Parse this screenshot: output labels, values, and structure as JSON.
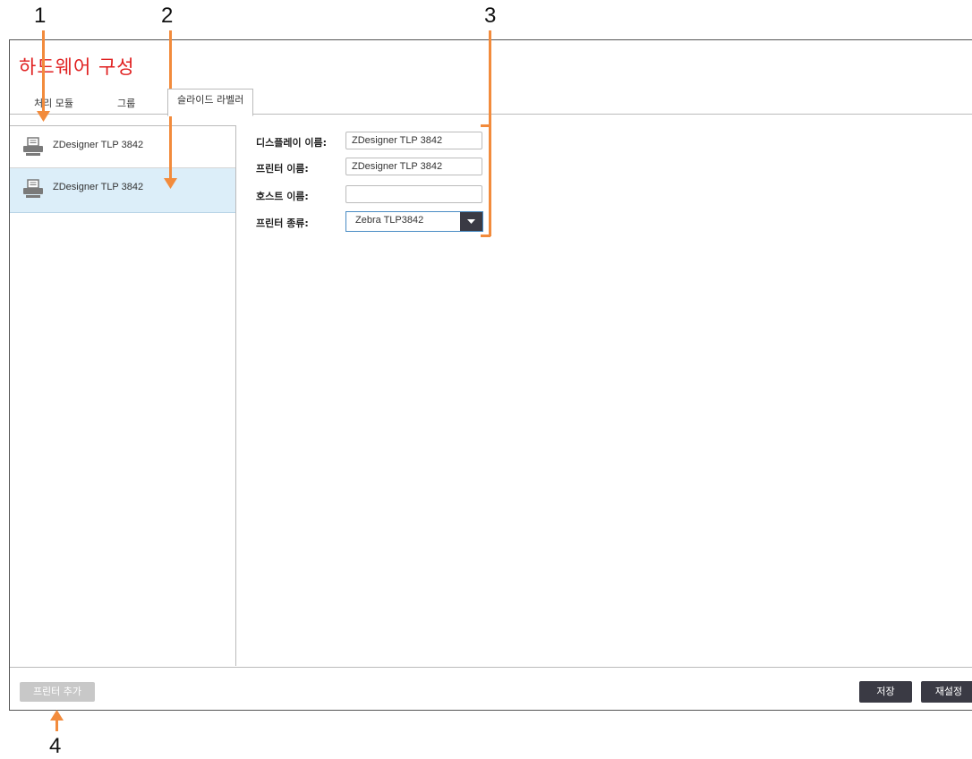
{
  "callouts": [
    "1",
    "2",
    "3",
    "4"
  ],
  "window": {
    "title": "하드웨어 구성"
  },
  "tabs": [
    {
      "label": "처리 모듈",
      "active": false
    },
    {
      "label": "그룹",
      "active": false
    },
    {
      "label": "슬라이드 라벨러",
      "active": true
    }
  ],
  "printers": [
    {
      "name": "ZDesigner TLP 3842",
      "selected": false,
      "icon": "printer-icon"
    },
    {
      "name": "ZDesigner TLP 3842",
      "selected": true,
      "icon": "printer-icon"
    }
  ],
  "form": {
    "display_name_label": "디스플레이 이름:",
    "display_name_value": "ZDesigner TLP 3842",
    "printer_name_label": "프린터 이름:",
    "printer_name_value": "ZDesigner TLP 3842",
    "host_name_label": "호스트 이름:",
    "host_name_value": "",
    "printer_type_label": "프린터 종류:",
    "printer_type_value": "Zebra TLP3842"
  },
  "footer": {
    "add_printer_label": "프린터 추가",
    "save_label": "저장",
    "reset_label": "재설정"
  },
  "colors": {
    "title": "#e02020",
    "accent_callout": "#f28b3c",
    "selected_row": "#dceef9",
    "dark_button": "#3a3a44"
  }
}
